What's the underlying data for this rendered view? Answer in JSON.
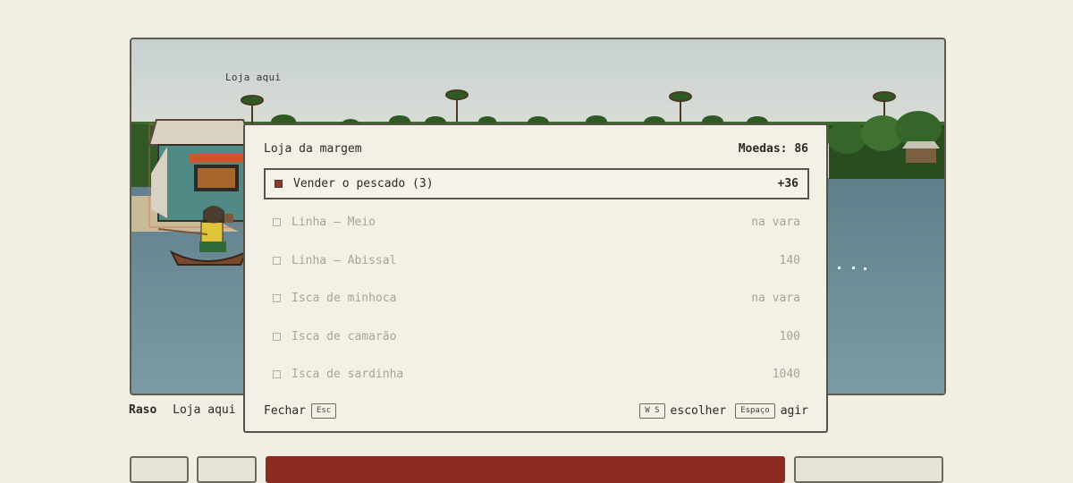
{
  "scene": {
    "shop_label": "Loja aqui"
  },
  "status": {
    "zone": "Raso",
    "hint": "Loja aqui"
  },
  "shop": {
    "title": "Loja da margem",
    "coins_label": "Moedas: 86",
    "items": [
      {
        "name": "Vender o pescado (3)",
        "value": "+36",
        "selected": true
      },
      {
        "name": "Linha — Meio",
        "value": "na vara",
        "selected": false
      },
      {
        "name": "Linha — Abissal",
        "value": "140",
        "selected": false
      },
      {
        "name": "Isca de minhoca",
        "value": "na vara",
        "selected": false
      },
      {
        "name": "Isca de camarão",
        "value": "100",
        "selected": false
      },
      {
        "name": "Isca de sardinha",
        "value": "1040",
        "selected": false
      }
    ],
    "footer": {
      "close_label": "Fechar",
      "close_key": "Esc",
      "choose_key": "W S",
      "choose_label": "escolher",
      "act_key": "Espaço",
      "act_label": "agir"
    }
  },
  "colors": {
    "accent": "#8c2a21",
    "water": "#6f8f9a",
    "sky": "#cfd6d4"
  }
}
